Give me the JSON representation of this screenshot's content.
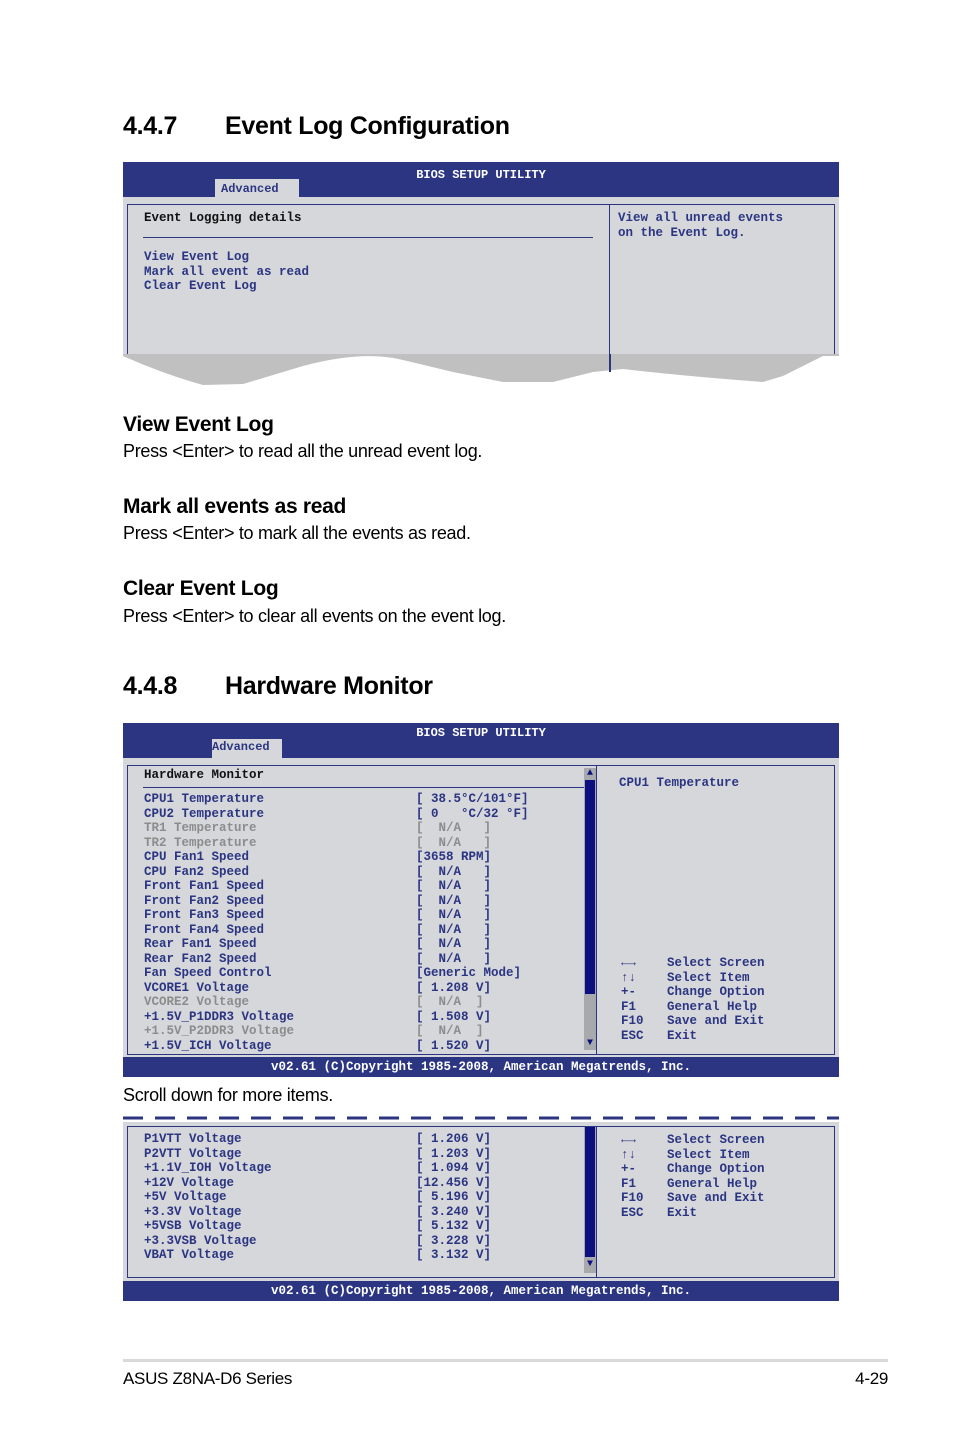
{
  "section_447": {
    "number": "4.4.7",
    "title": "Event Log Configuration"
  },
  "bios1": {
    "utility_title": "BIOS SETUP UTILITY",
    "tab": "Advanced",
    "panel_heading": "Event Logging details",
    "items": [
      "View Event Log",
      "Mark all event as read",
      "Clear Event Log"
    ],
    "help_text": [
      "View all unread events",
      "on the Event Log."
    ]
  },
  "subsections": [
    {
      "title": "View Event Log",
      "desc": "Press <Enter> to read all the unread event log."
    },
    {
      "title": "Mark all events as read",
      "desc": "Press <Enter> to mark all the events as read."
    },
    {
      "title": "Clear Event Log",
      "desc": "Press <Enter> to clear all events on the event log."
    }
  ],
  "section_448": {
    "number": "4.4.8",
    "title": "Hardware Monitor"
  },
  "bios2": {
    "utility_title": "BIOS SETUP UTILITY",
    "tab": "Advanced",
    "panel_heading": "Hardware Monitor",
    "rows": [
      {
        "label": "CPU1 Temperature",
        "value": "[ 38.5°C/101°F]",
        "state": "active"
      },
      {
        "label": "CPU2 Temperature",
        "value": "[ 0   °C/32 °F]",
        "state": "active"
      },
      {
        "label": "TR1 Temperature",
        "value": "[  N/A   ]",
        "state": "disabled"
      },
      {
        "label": "TR2 Temperature",
        "value": "[  N/A   ]",
        "state": "disabled"
      },
      {
        "label": "CPU Fan1 Speed",
        "value": "[3658 RPM]",
        "state": "active"
      },
      {
        "label": "CPU Fan2 Speed",
        "value": "[  N/A   ]",
        "state": "active"
      },
      {
        "label": "Front Fan1 Speed",
        "value": "[  N/A   ]",
        "state": "active"
      },
      {
        "label": "Front Fan2 Speed",
        "value": "[  N/A   ]",
        "state": "active"
      },
      {
        "label": "Front Fan3 Speed",
        "value": "[  N/A   ]",
        "state": "active"
      },
      {
        "label": "Front Fan4 Speed",
        "value": "[  N/A   ]",
        "state": "active"
      },
      {
        "label": "Rear Fan1 Speed",
        "value": "[  N/A   ]",
        "state": "active"
      },
      {
        "label": "Rear Fan2 Speed",
        "value": "[  N/A   ]",
        "state": "active"
      },
      {
        "label": "Fan Speed Control",
        "value": "[Generic Mode]",
        "state": "active"
      },
      {
        "label": "VCORE1 Voltage",
        "value": "[ 1.208 V]",
        "state": "active"
      },
      {
        "label": "VCORE2 Voltage",
        "value": "[  N/A  ]",
        "state": "disabled"
      },
      {
        "label": "+1.5V_P1DDR3 Voltage",
        "value": "[ 1.508 V]",
        "state": "active"
      },
      {
        "label": "+1.5V_P2DDR3 Voltage",
        "value": "[  N/A  ]",
        "state": "disabled"
      },
      {
        "label": "+1.5V_ICH Voltage",
        "value": "[ 1.520 V]",
        "state": "active"
      }
    ],
    "help_text": "CPU1 Temperature",
    "keys": [
      {
        "key": "←→",
        "desc": "Select Screen"
      },
      {
        "key": "↑↓",
        "desc": "Select Item"
      },
      {
        "key": "+-",
        "desc": "Change Option"
      },
      {
        "key": "F1",
        "desc": "General Help"
      },
      {
        "key": "F10",
        "desc": "Save and Exit"
      },
      {
        "key": "ESC",
        "desc": "Exit"
      }
    ],
    "scroll_up": "▲",
    "scroll_down": "▼",
    "footer": "v02.61 (C)Copyright 1985-2008, American Megatrends, Inc."
  },
  "scroll_note": "Scroll down for more items.",
  "bios3": {
    "rows": [
      {
        "label": "P1VTT Voltage",
        "value": "[ 1.206 V]"
      },
      {
        "label": "P2VTT Voltage",
        "value": "[ 1.203 V]"
      },
      {
        "label": "+1.1V_IOH Voltage",
        "value": "[ 1.094 V]"
      },
      {
        "label": "+12V Voltage",
        "value": "[12.456 V]"
      },
      {
        "label": "+5V Voltage",
        "value": "[ 5.196 V]"
      },
      {
        "label": "+3.3V Voltage",
        "value": "[ 3.240 V]"
      },
      {
        "label": "+5VSB Voltage",
        "value": "[ 5.132 V]"
      },
      {
        "label": "+3.3VSB Voltage",
        "value": "[ 3.228 V]"
      },
      {
        "label": "VBAT Voltage",
        "value": "[ 3.132 V]"
      }
    ],
    "keys": [
      {
        "key": "←→",
        "desc": "Select Screen"
      },
      {
        "key": "↑↓",
        "desc": "Select Item"
      },
      {
        "key": "+-",
        "desc": "Change Option"
      },
      {
        "key": "F1",
        "desc": "General Help"
      },
      {
        "key": "F10",
        "desc": "Save and Exit"
      },
      {
        "key": "ESC",
        "desc": "Exit"
      }
    ],
    "scroll_down": "▼",
    "footer": "v02.61 (C)Copyright 1985-2008, American Megatrends, Inc."
  },
  "page_footer": {
    "product": "ASUS Z8NA-D6 Series",
    "page_number": "4-29"
  }
}
